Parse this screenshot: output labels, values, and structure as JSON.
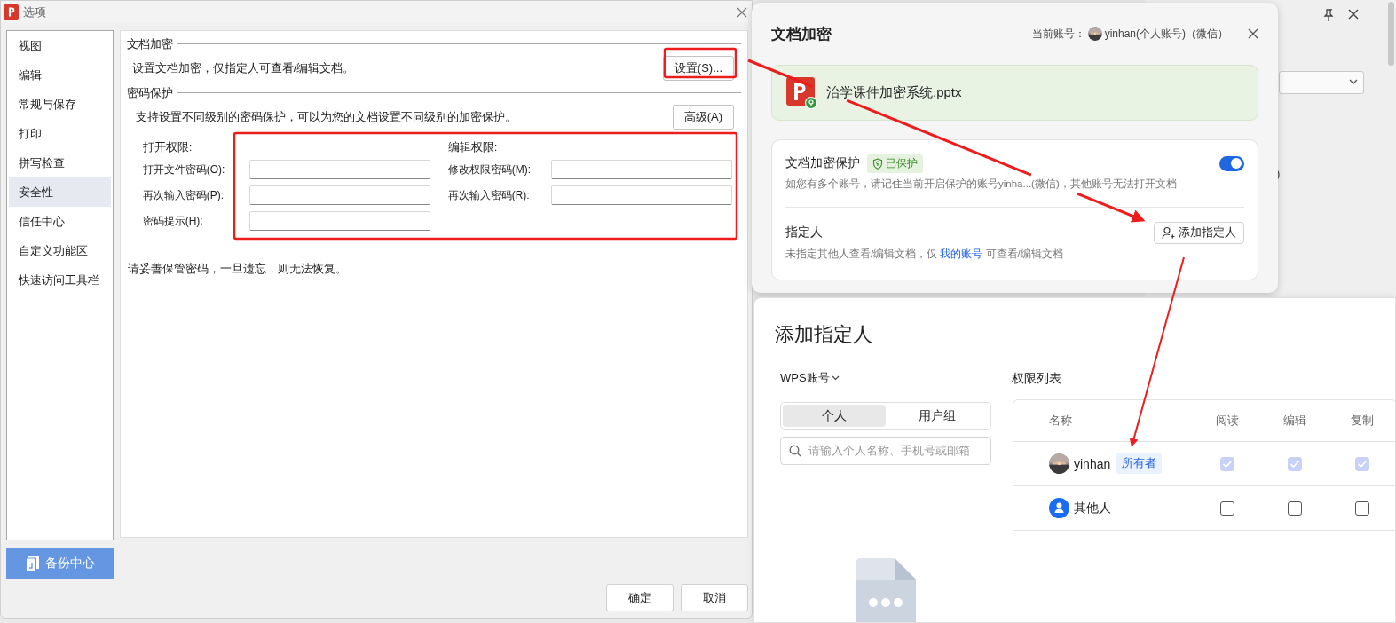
{
  "options_dialog": {
    "title": "选项",
    "sidebar": [
      {
        "label": "视图",
        "selected": false
      },
      {
        "label": "编辑",
        "selected": false
      },
      {
        "label": "常规与保存",
        "selected": false
      },
      {
        "label": "打印",
        "selected": false
      },
      {
        "label": "拼写检查",
        "selected": false
      },
      {
        "label": "安全性",
        "selected": true
      },
      {
        "label": "信任中心",
        "selected": false
      },
      {
        "label": "自定义功能区",
        "selected": false
      },
      {
        "label": "快速访问工具栏",
        "selected": false
      }
    ],
    "backup_button": "备份中心",
    "doc_encryption": {
      "heading": "文档加密",
      "description": "设置文档加密，仅指定人可查看/编辑文档。",
      "button": "设置(S)..."
    },
    "password_protection": {
      "heading": "密码保护",
      "description": "支持设置不同级别的密码保护，可以为您的文档设置不同级别的加密保护。",
      "button": "高级(A)",
      "open_group": {
        "label": "打开权限:",
        "fields": [
          {
            "label": "打开文件密码(O):"
          },
          {
            "label": "再次输入密码(P):"
          },
          {
            "label": "密码提示(H):"
          }
        ]
      },
      "edit_group": {
        "label": "编辑权限:",
        "fields": [
          {
            "label": "修改权限密码(M):"
          },
          {
            "label": "再次输入密码(R):"
          }
        ]
      }
    },
    "warning": "请妥善保管密码，一旦遗忘，则无法恢复。",
    "buttons": [
      "确定",
      "取消"
    ]
  },
  "encryption_popup": {
    "title": "文档加密",
    "account_label": "当前账号：",
    "account": "yinhan(个人账号)（微信）",
    "file_name": "治学课件加密系统.pptx",
    "protection": {
      "label": "文档加密保护",
      "status": "已保护",
      "on": true,
      "note": "如您有多个账号，请记住当前开启保护的账号yinha...(微信)，其他账号无法打开文档"
    },
    "designee": {
      "label": "指定人",
      "button": "添加指定人",
      "note_before": "未指定其他人查看/编辑文档，仅",
      "link": "我的账号",
      "note_after": "可查看/编辑文档"
    }
  },
  "add_designee_dialog": {
    "title": "添加指定人",
    "account_type": "WPS账号",
    "tabs": [
      {
        "label": "个人",
        "selected": true
      },
      {
        "label": "用户组",
        "selected": false
      }
    ],
    "search": {
      "placeholder": "请输入个人名称、手机号或邮箱"
    },
    "list_title": "权限列表",
    "columns": [
      "名称",
      "阅读",
      "编辑",
      "复制"
    ],
    "rows": [
      {
        "kind": "owner",
        "name": "yinhan",
        "badge": "所有者",
        "read": true,
        "edit": true,
        "copy": true,
        "locked": true
      },
      {
        "kind": "others",
        "name": "其他人",
        "read": false,
        "edit": false,
        "copy": false,
        "locked": false
      }
    ]
  },
  "background_panel": {
    "partial_text": ")"
  }
}
